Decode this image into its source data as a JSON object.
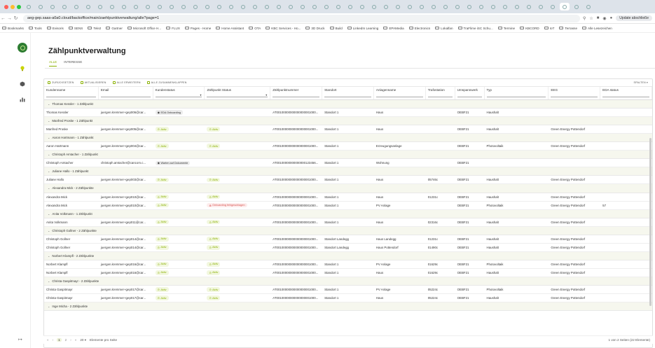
{
  "browser": {
    "url": "aeg-gep.saas-a0a0.cloud/backoffice/main/zaehlpunktverwaltung/alle?page=1",
    "update_label": "Update abschließe"
  },
  "bookmarks": [
    "Bookmarks",
    "Tools",
    "Evisoris",
    "SENS",
    "Tele2",
    "Gartner",
    "Microsoft Office H...",
    "FLUX",
    "Pages - Home",
    "Home Assistant",
    "OTA",
    "KBC Services - Ho...",
    "3D Druck",
    "Build",
    "LinkedIn Learning",
    "EPAMedia",
    "Electronics",
    "Lokalfan",
    "TraFlime iSC Sc​hu...",
    "Termine",
    "KBCORD",
    "IoT",
    "Terrasse",
    "Alle Lesezeichen"
  ],
  "page": {
    "title": "Zählpunktverwaltung",
    "tabs": [
      "ALLE",
      "INTERESSE"
    ]
  },
  "toolbar": {
    "buttons": [
      "ZURÜCKSETZEN",
      "AKTUALISIEREN",
      "ALLE ERWEITERN",
      "ALLE ZUSAMMENKLAPPEN"
    ],
    "columns_label": "SPALTEN"
  },
  "columns": [
    "Kundenname",
    "Email",
    "Kundenstatus",
    "Zählpunkt Status",
    "Zählpunktnummer",
    "Standort",
    "Anlagenname",
    "Trafostation",
    "Umspannwerk",
    "Typ",
    "EEG",
    "EDA status"
  ],
  "rows": [
    {
      "kind": "group",
      "label": "Thomas Kessler - 1 Zählpunkt"
    },
    {
      "kind": "row",
      "cells": [
        "Thomas Kessler",
        "juergen.kremmer+gep006@car...",
        {
          "chip": "onb",
          "text": "EDA Onboarding"
        },
        "",
        "AT00100000000000000001000...",
        "Standort 1",
        "Haus",
        "",
        "OEBF21",
        "Haushalt",
        "",
        ""
      ]
    },
    {
      "kind": "group",
      "label": "Manfred Proske - 1 Zählpunkt"
    },
    {
      "kind": "row",
      "cells": [
        "Manfred Proske",
        "juergen.kremmer+gep005@car...",
        {
          "chip": "aktiv",
          "text": "Aktiv"
        },
        {
          "chip": "aktiv",
          "text": "Aktiv"
        },
        "AT00100000000000000001000...",
        "Standort 1",
        "Haus",
        "",
        "OEBF21",
        "Haushalt",
        "Green Energy Pottendorf",
        ""
      ]
    },
    {
      "kind": "group",
      "label": "Aaron Hartmann - 1 Zählpunkt"
    },
    {
      "kind": "row",
      "cells": [
        "Aaron Hartmann",
        "juergen.kremmer+gep004@car...",
        {
          "chip": "aktiv",
          "text": "Aktiv"
        },
        {
          "chip": "aktiv",
          "text": "Aktiv"
        },
        "AT00100000000000000001000...",
        "Standort 1",
        "Erzeugungsanlage",
        "",
        "OEBF21",
        "Photovoltaik",
        "Green Energy Pottendorf",
        ""
      ]
    },
    {
      "kind": "group",
      "label": "Christoph Amtacher - 1 Zählpunkt"
    },
    {
      "kind": "row",
      "cells": [
        "Christoph Amtacher",
        "christoph.amtacher@cancom.c...",
        {
          "chip": "onb",
          "text": "Warten auf Dokumente"
        },
        "",
        "AT00100000000000000123456...",
        "Standort 1",
        "Wohnung",
        "",
        "OEBF21",
        "",
        "",
        ""
      ]
    },
    {
      "kind": "group",
      "label": "Juliane Hallo - 1 Zählpunkt"
    },
    {
      "kind": "row",
      "cells": [
        "Juliane Hallo",
        "juergen.kremmer+gep003@car...",
        {
          "chip": "aktiv",
          "text": "Aktiv"
        },
        {
          "chip": "aktiv",
          "text": "Aktiv"
        },
        "AT00100000000000000001000...",
        "Standort 1",
        "Haus",
        "05746c",
        "OEBF21",
        "Haushalt",
        "Green Energy Pottendorf",
        ""
      ]
    },
    {
      "kind": "group",
      "label": "Alexandra Mick - 2 Zählpunkte"
    },
    {
      "kind": "row",
      "cells": [
        "Alexandra Mick",
        "juergen.kremmer+gep010@car...",
        {
          "chip": "aktiv",
          "text": "Aktiv"
        },
        {
          "chip": "aktiv",
          "text": "Aktiv"
        },
        "AT00100000000000000001000...",
        "Standort 1",
        "Haus",
        "01231c",
        "OEBF21",
        "Haushalt",
        "Green Energy Pottendorf",
        ""
      ]
    },
    {
      "kind": "row",
      "cells": [
        "Alexandra Mick",
        "juergen.kremmer+gep010@car...",
        {
          "chip": "aktiv",
          "text": "Aktiv"
        },
        {
          "chip": "fail",
          "text": "Onboarding fehlgeschlagen"
        },
        "AT00100000000000000001000...",
        "Standort 1",
        "PV Anlage",
        "",
        "OEBF21",
        "Photovoltaik",
        "Green Energy Pottendorf",
        "57"
      ]
    },
    {
      "kind": "group",
      "label": "Anita Volkmann - 1 Zählpunkt"
    },
    {
      "kind": "row",
      "cells": [
        "Anita Volkmann",
        "juergen.kremmer+gep011@car...",
        {
          "chip": "aktiv",
          "text": "Aktiv"
        },
        {
          "chip": "aktiv",
          "text": "Aktiv"
        },
        "AT00100000000000000001000...",
        "Standort 1",
        "Haus",
        "02316c",
        "OEBF21",
        "Haushalt",
        "Green Energy Pottendorf",
        ""
      ]
    },
    {
      "kind": "group",
      "label": "Christoph Gollner - 2 Zählpunkte"
    },
    {
      "kind": "row",
      "cells": [
        "Christoph Gollner",
        "juergen.kremmer+gep014@car...",
        {
          "chip": "aktiv",
          "text": "Aktiv"
        },
        {
          "chip": "aktiv",
          "text": "Aktiv"
        },
        "AT00100000000000000001000...",
        "Standort Landegg",
        "Haus Landegg",
        "01231c",
        "OEBF21",
        "Haushalt",
        "Green Energy Pottendorf",
        ""
      ]
    },
    {
      "kind": "row",
      "cells": [
        "Christoph Gollner",
        "juergen.kremmer+gep014@car...",
        {
          "chip": "aktiv",
          "text": "Aktiv"
        },
        {
          "chip": "aktiv",
          "text": "Aktiv"
        },
        "AT00100000000000000001000...",
        "Standort Landegg",
        "Haus Pottendorf",
        "01490c",
        "OEBF21",
        "Haushalt",
        "Green Energy Pottendorf",
        ""
      ]
    },
    {
      "kind": "group",
      "label": "Norbert Klampfl - 2 Zählpunkte"
    },
    {
      "kind": "row",
      "cells": [
        "Norbert Klampfl",
        "juergen.kremmer+gep016@car...",
        {
          "chip": "aktiv",
          "text": "Aktiv"
        },
        {
          "chip": "aktiv",
          "text": "Aktiv"
        },
        "AT00100000000000000001000...",
        "Standort 1",
        "PV Anlage",
        "01629c",
        "OEBF21",
        "Photovoltaik",
        "Green Energy Pottendorf",
        ""
      ]
    },
    {
      "kind": "row",
      "cells": [
        "Norbert Klampfl",
        "juergen.kremmer+gep016@car...",
        {
          "chip": "aktiv",
          "text": "Aktiv"
        },
        {
          "chip": "aktiv",
          "text": "Aktiv"
        },
        "AT00100000000000000001000...",
        "Standort 1",
        "Haus",
        "01629c",
        "OEBF21",
        "Haushalt",
        "Green Energy Pottendorf",
        ""
      ]
    },
    {
      "kind": "group",
      "label": "Christa Gaspitmayr - 2 Zählpunkte"
    },
    {
      "kind": "row",
      "cells": [
        "Christa Gaspitmayr",
        "juergen.kremmer+gep017@car...",
        {
          "chip": "aktiv",
          "text": "Aktiv"
        },
        {
          "chip": "aktiv",
          "text": "Aktiv"
        },
        "AT00100000000000000001000...",
        "Standort 1",
        "PV Anlage",
        "05224c",
        "OEBF21",
        "Photovoltaik",
        "Green Energy Pottendorf",
        ""
      ]
    },
    {
      "kind": "row",
      "cells": [
        "Christa Gaspitmayr",
        "juergen.kremmer+gep017@car...",
        {
          "chip": "aktiv",
          "text": "Aktiv"
        },
        {
          "chip": "aktiv",
          "text": "Aktiv"
        },
        "AT00100000000000000001000...",
        "Standort 1",
        "Haus",
        "05224c",
        "OEBF21",
        "Haushalt",
        "Green Energy Pottendorf",
        ""
      ]
    },
    {
      "kind": "group",
      "label": "Inge Micha - 2 Zählpunkte"
    }
  ],
  "pager": {
    "pages": [
      "1",
      "2"
    ],
    "current": "1",
    "page_size": "20",
    "per_page_label": "Elemente pro Seite",
    "summary": "1 von 2 Seiten (22 Elemente)"
  },
  "colors": {
    "accent": "#8ab000",
    "group_bg": "#f6f7ee",
    "logo": "#2e7d32"
  }
}
